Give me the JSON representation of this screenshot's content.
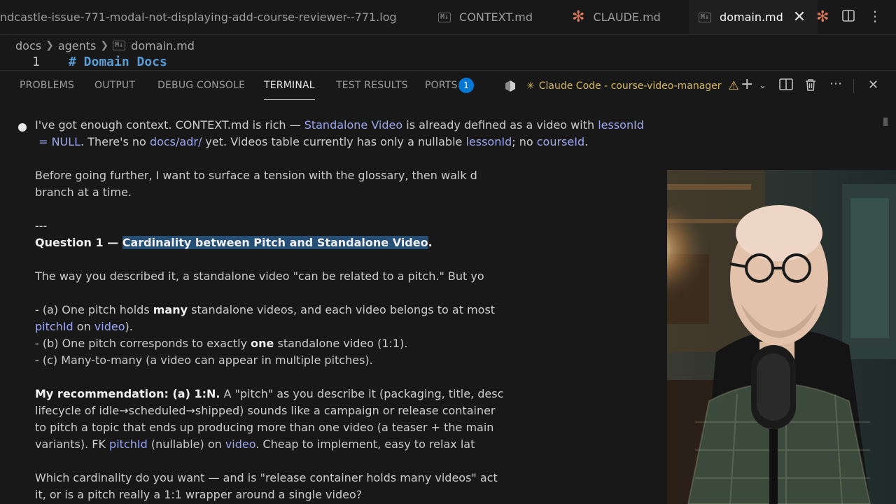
{
  "tabs": [
    {
      "label": "ndcastle-issue-771-modal-not-displaying-add-course-reviewer--771.log"
    },
    {
      "label": "CONTEXT.md",
      "icon": "markdown-icon"
    },
    {
      "label": "CLAUDE.md",
      "icon": "claude-icon"
    },
    {
      "label": "domain.md",
      "icon": "markdown-icon",
      "active": true
    }
  ],
  "breadcrumb": [
    "docs",
    "agents",
    "domain.md"
  ],
  "editor": {
    "line_number": "1",
    "code": "# Domain Docs"
  },
  "panel": {
    "tabs": [
      "PROBLEMS",
      "OUTPUT",
      "DEBUG CONSOLE",
      "TERMINAL",
      "TEST RESULTS",
      "PORTS"
    ],
    "active_tab": "TERMINAL",
    "ports_badge": "1",
    "terminal_session": "Claude Code - course-video-manager"
  },
  "terminal": {
    "l1": {
      "a": "I've got enough context. CONTEXT.md is rich — ",
      "b": "Standalone Video",
      "c": " is already defined as a video with ",
      "d": "lessonId"
    },
    "l2": {
      "a": " = NULL",
      "b": ". There's no ",
      "c": "docs/adr/",
      "d": " yet. Videos table currently has only a nullable ",
      "e": "lessonId",
      "f": "; no ",
      "g": "courseId",
      "h": "."
    },
    "l3": "Before going further, I want to surface a tension with the glossary, then walk d",
    "l4": "branch at a time.",
    "l5": "---",
    "l6": {
      "a": "Question 1 — ",
      "b": "Cardinality between Pitch and Standalone Video",
      "c": "."
    },
    "l7": "The way you described it, a standalone video \"can be related to a pitch.\" But yo",
    "l8": {
      "a": "- (a) One pitch holds ",
      "b": "many",
      "c": " standalone videos, and each video belongs to at most"
    },
    "l9": {
      "a": "pitchId",
      "b": " on ",
      "c": "video",
      "d": ")."
    },
    "l10": {
      "a": "- (b) One pitch corresponds to exactly ",
      "b": "one",
      "c": " standalone video (1:1)."
    },
    "l11": "- (c) Many-to-many (a video can appear in multiple pitches).",
    "l12": {
      "a": "My recommendation: (a) 1:N.",
      "b": " A \"pitch\" as you describe it (packaging, title, desc"
    },
    "l13": "lifecycle of idle→scheduled→shipped) sounds like a campaign or release container",
    "l14": "to pitch a topic that ends up producing more than one video (a teaser + the main",
    "l15": {
      "a": "variants). FK ",
      "b": "pitchId",
      "c": " (nullable) on ",
      "d": "video",
      "e": ". Cheap to implement, easy to relax lat"
    },
    "l16": "Which cardinality do you want — and is \"release container holds many videos\" act",
    "l17": "it, or is a pitch really a 1:1 wrapper around a single video?"
  },
  "colors": {
    "accent": "#0078d4",
    "link_text": "#9aa7f0",
    "selection": "#264f78",
    "claude": "#d97757"
  }
}
